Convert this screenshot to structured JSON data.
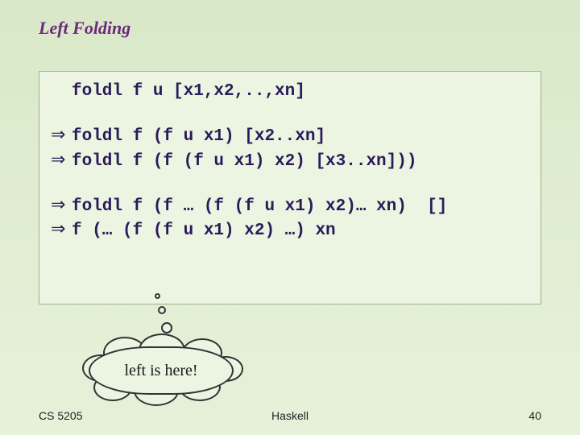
{
  "title": "Left Folding",
  "code": {
    "line1": "foldl f u [x1,x2,..,xn]",
    "line2": "foldl f (f u x1) [x2..xn]",
    "line3": "foldl f (f (f u x1) x2) [x3..xn]))",
    "line4": "foldl f (f … (f (f u x1) x2)… xn)  []",
    "line5": "f (… (f (f u x1) x2) …) xn"
  },
  "callout": "left is here!",
  "footer": {
    "left": "CS 5205",
    "center": "Haskell",
    "right": "40"
  },
  "glyphs": {
    "double_arrow": "⇒"
  }
}
